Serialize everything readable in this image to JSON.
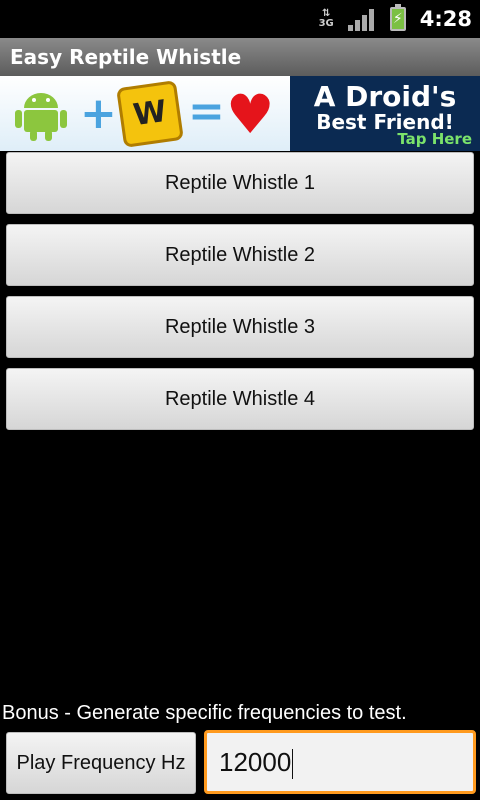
{
  "status_bar": {
    "network": "3G",
    "time": "4:28"
  },
  "app": {
    "title": "Easy Reptile Whistle"
  },
  "ad": {
    "tile_letter": "W",
    "line1": "A Droid's",
    "line2": "Best Friend!",
    "line3": "Tap Here"
  },
  "buttons": [
    {
      "label": "Reptile Whistle 1"
    },
    {
      "label": "Reptile Whistle 2"
    },
    {
      "label": "Reptile Whistle 3"
    },
    {
      "label": "Reptile Whistle 4"
    }
  ],
  "bonus": {
    "text": "Bonus - Generate specific frequencies to test.",
    "play_label": "Play Frequency Hz",
    "frequency_value": "12000"
  },
  "colors": {
    "focus_border": "#ff9a1e",
    "titlebar": "#6f6f6f",
    "ad_dark": "#0b2a52"
  }
}
